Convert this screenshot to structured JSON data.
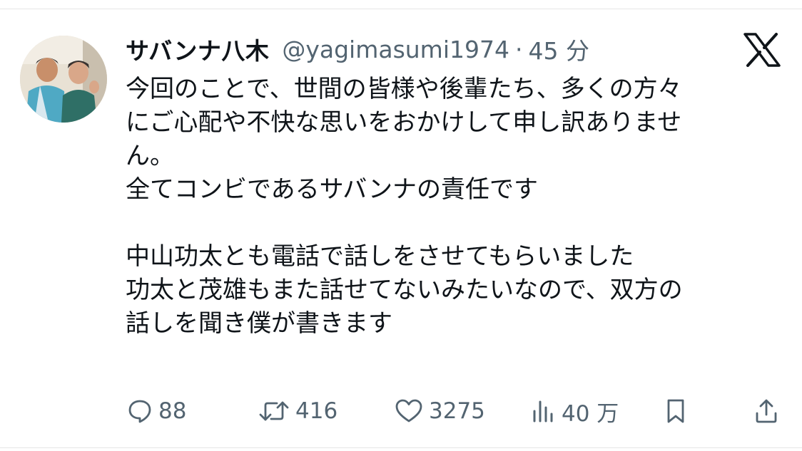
{
  "tweet": {
    "author_name": "サバンナ八木",
    "handle": "@yagimasumi1974",
    "separator": "·",
    "time": "45 分",
    "lines": [
      "今回のことで、世間の皆様や後輩たち、多くの方々",
      "にご心配や不快な思いをおかけして申し訳ありませ",
      "ん。",
      "全てコンビであるサバンナの責任です",
      "",
      "中山功太とも電話で話しをさせてもらいました",
      "功太と茂雄もまた話せてないみたいなので、双方の",
      "話しを聞き僕が書きます"
    ]
  },
  "actions": {
    "replies": "88",
    "retweets": "416",
    "likes": "3275",
    "views": "40 万"
  },
  "icons": {
    "platform": "x-logo-icon",
    "reply": "speech-bubble-icon",
    "retweet": "retweet-arrows-icon",
    "like": "heart-icon",
    "views": "bar-chart-icon",
    "bookmark": "bookmark-icon",
    "share": "share-upload-icon"
  },
  "colors": {
    "text": "#0f1419",
    "secondary": "#536471"
  }
}
